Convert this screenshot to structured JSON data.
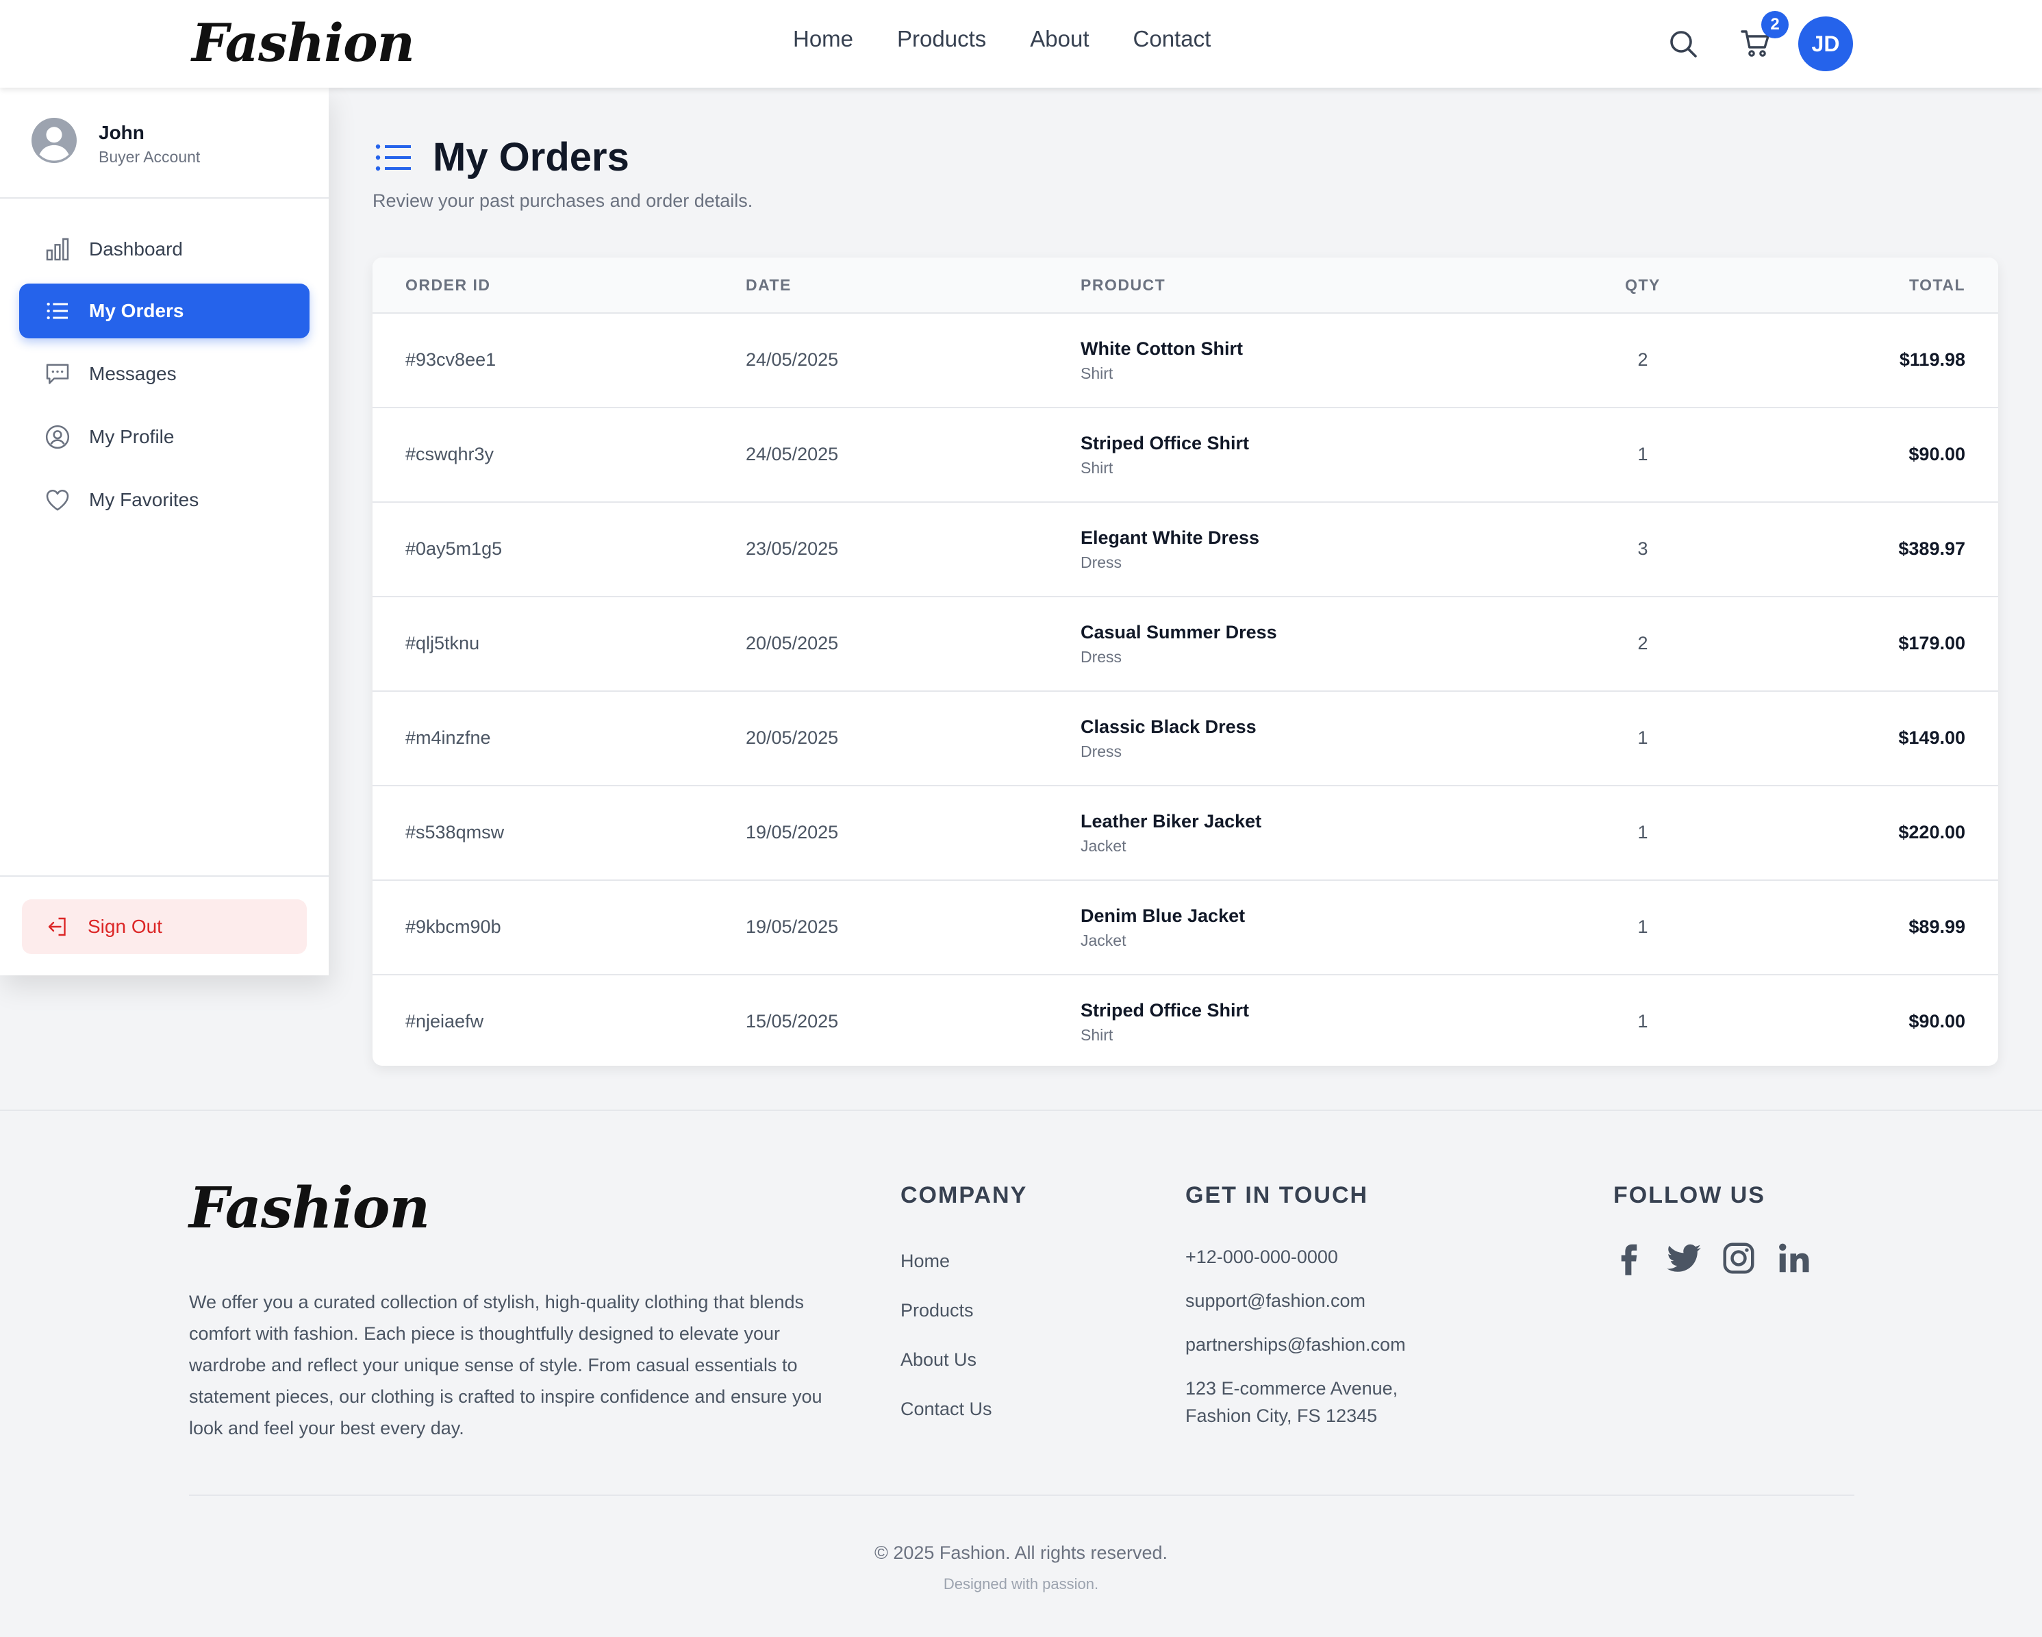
{
  "brand": {
    "name": "Fashion",
    "accent": "#2563eb",
    "danger": "#dc2626"
  },
  "header": {
    "nav": [
      "Home",
      "Products",
      "About",
      "Contact"
    ],
    "cart_count": "2",
    "avatar_initials": "JD",
    "icons": [
      "search-icon",
      "cart-icon"
    ]
  },
  "sidebar": {
    "user": {
      "name": "John",
      "role": "Buyer Account"
    },
    "items": [
      {
        "label": "Dashboard",
        "icon": "bar-chart-icon",
        "active": false
      },
      {
        "label": "My Orders",
        "icon": "list-icon",
        "active": true
      },
      {
        "label": "Messages",
        "icon": "chat-icon",
        "active": false
      },
      {
        "label": "My Profile",
        "icon": "user-circle-icon",
        "active": false
      },
      {
        "label": "My Favorites",
        "icon": "heart-icon",
        "active": false
      }
    ],
    "sign_out": "Sign Out"
  },
  "main": {
    "title": "My Orders",
    "subtitle": "Review your past purchases and order details.",
    "columns": [
      "ORDER ID",
      "DATE",
      "PRODUCT",
      "QTY",
      "TOTAL"
    ],
    "orders": [
      {
        "id": "#93cv8ee1",
        "date": "24/05/2025",
        "product": "White Cotton Shirt",
        "category": "Shirt",
        "qty": "2",
        "total": "$119.98"
      },
      {
        "id": "#cswqhr3y",
        "date": "24/05/2025",
        "product": "Striped Office Shirt",
        "category": "Shirt",
        "qty": "1",
        "total": "$90.00"
      },
      {
        "id": "#0ay5m1g5",
        "date": "23/05/2025",
        "product": "Elegant White Dress",
        "category": "Dress",
        "qty": "3",
        "total": "$389.97"
      },
      {
        "id": "#qlj5tknu",
        "date": "20/05/2025",
        "product": "Casual Summer Dress",
        "category": "Dress",
        "qty": "2",
        "total": "$179.00"
      },
      {
        "id": "#m4inzfne",
        "date": "20/05/2025",
        "product": "Classic Black Dress",
        "category": "Dress",
        "qty": "1",
        "total": "$149.00"
      },
      {
        "id": "#s538qmsw",
        "date": "19/05/2025",
        "product": "Leather Biker Jacket",
        "category": "Jacket",
        "qty": "1",
        "total": "$220.00"
      },
      {
        "id": "#9kbcm90b",
        "date": "19/05/2025",
        "product": "Denim Blue Jacket",
        "category": "Jacket",
        "qty": "1",
        "total": "$89.99"
      },
      {
        "id": "#njeiaefw",
        "date": "15/05/2025",
        "product": "Striped Office Shirt",
        "category": "Shirt",
        "qty": "1",
        "total": "$90.00"
      }
    ]
  },
  "footer": {
    "description": "We offer you a curated collection of stylish, high-quality clothing that blends comfort with fashion. Each piece is thoughtfully designed to elevate your wardrobe and reflect your unique sense of style. From casual essentials to statement pieces, our clothing is crafted to inspire confidence and ensure you look and feel your best every day.",
    "company": {
      "heading": "COMPANY",
      "links": [
        "Home",
        "Products",
        "About Us",
        "Contact Us"
      ]
    },
    "contact": {
      "heading": "GET IN TOUCH",
      "phone": "+12-000-000-0000",
      "email": "support@fashion.com",
      "partners": "partnerships@fashion.com",
      "address_line1": "123 E-commerce Avenue,",
      "address_line2": "Fashion City, FS 12345"
    },
    "follow": {
      "heading": "FOLLOW US",
      "icons": [
        "facebook-icon",
        "twitter-icon",
        "instagram-icon",
        "linkedin-icon"
      ]
    },
    "copyright": "© 2025 Fashion. All rights reserved.",
    "tagline": "Designed with passion."
  }
}
